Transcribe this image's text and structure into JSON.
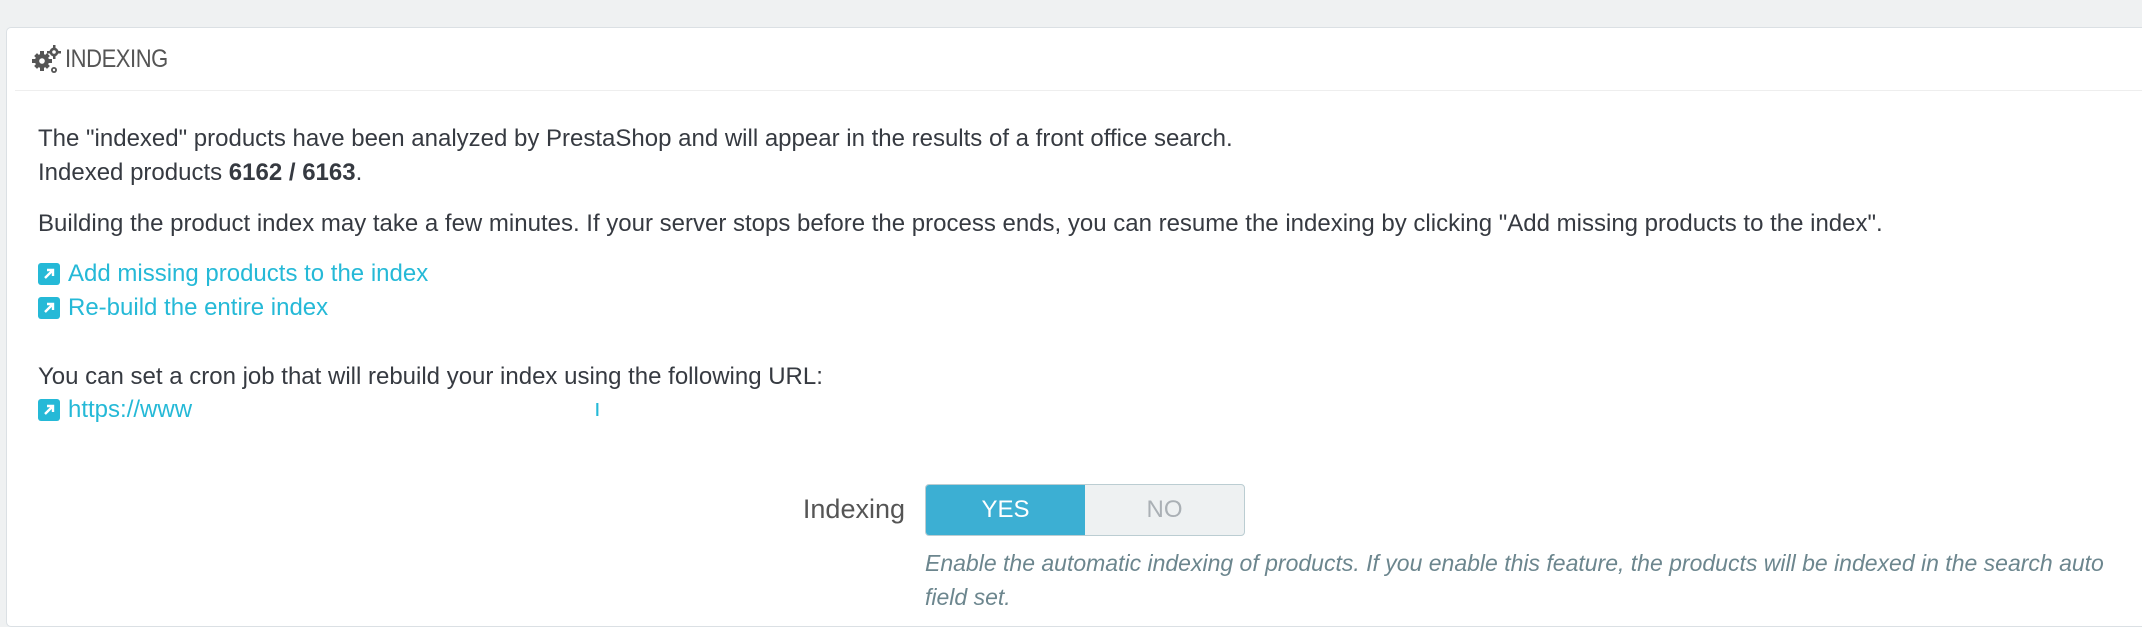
{
  "panel": {
    "title": "INDEXING",
    "icon": "cogs-icon"
  },
  "content": {
    "intro_line": "The \"indexed\" products have been analyzed by PrestaShop and will appear in the results of a front office search.",
    "indexed_prefix": "Indexed products ",
    "indexed_count": "6162 / 6163",
    "indexed_suffix": ".",
    "build_note": "Building the product index may take a few minutes. If your server stops before the process ends, you can resume the indexing by clicking \"Add missing products to the index\".",
    "link_add_missing": "Add missing products to the index",
    "link_rebuild": "Re-build the entire index",
    "cron_text": "You can set a cron job that will rebuild your index using the following URL:",
    "cron_url_visible": "https://www",
    "cron_url_tail": "ı"
  },
  "form": {
    "indexing_label": "Indexing",
    "yes_label": "YES",
    "no_label": "NO",
    "selected": "YES",
    "help_line1": "Enable the automatic indexing of products. If you enable this feature, the products will be indexed in the search auto",
    "help_line2": "field set."
  },
  "colors": {
    "link": "#25b9d7",
    "switch_on": "#3cafd3",
    "background": "#eff1f2"
  }
}
